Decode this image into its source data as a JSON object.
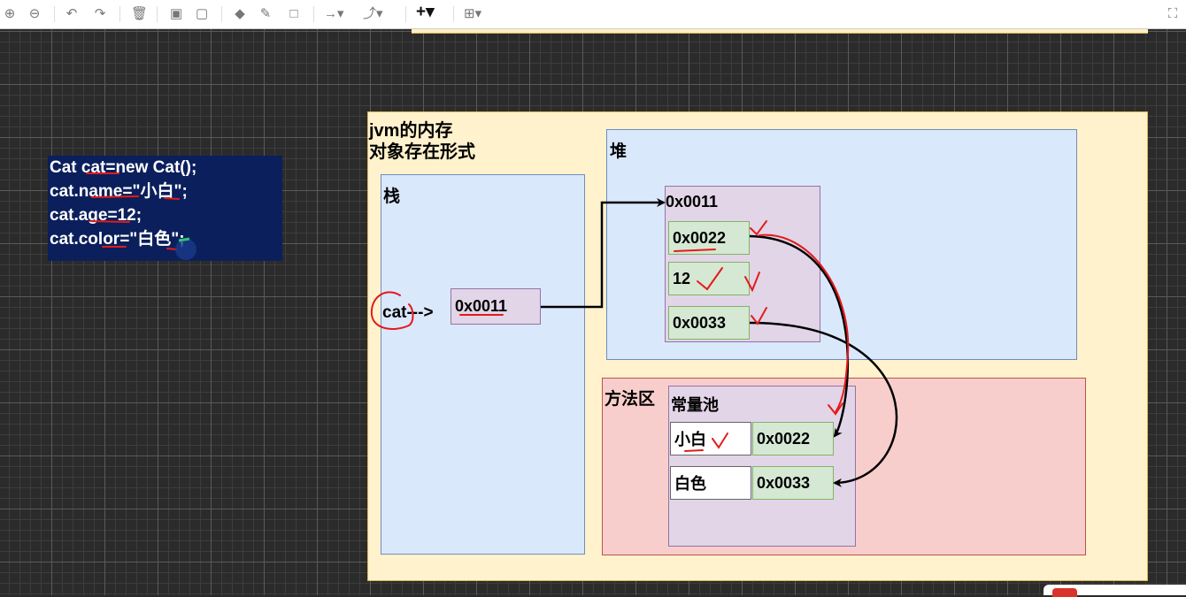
{
  "toolbar": {
    "items": [
      {
        "name": "zoom-in-icon",
        "glyph": "⊕"
      },
      {
        "name": "zoom-out-icon",
        "glyph": "⊖"
      },
      {
        "name": "undo-icon",
        "glyph": "↶"
      },
      {
        "name": "redo-icon",
        "glyph": "↷"
      },
      {
        "name": "delete-icon",
        "glyph": "🗑"
      },
      {
        "name": "to-front-icon",
        "glyph": "▣"
      },
      {
        "name": "to-back-icon",
        "glyph": "▢"
      },
      {
        "name": "fill-color-icon",
        "glyph": "◆"
      },
      {
        "name": "line-color-icon",
        "glyph": "✎"
      },
      {
        "name": "shadow-icon",
        "glyph": "□"
      },
      {
        "name": "connection-style-icon",
        "glyph": "→▾"
      },
      {
        "name": "waypoints-icon",
        "glyph": "⤴▾"
      },
      {
        "name": "insert-icon",
        "glyph": "+▾"
      },
      {
        "name": "table-icon",
        "glyph": "⊞▾"
      },
      {
        "name": "fullscreen-icon",
        "glyph": "⛶"
      }
    ]
  },
  "code": {
    "lines": [
      "Cat cat=new Cat();",
      "cat.name=\"小白\";",
      "cat.age=12;",
      "cat.color=\"白色\";"
    ]
  },
  "diagram": {
    "jvm_title_line1": "jvm的内存",
    "jvm_title_line2": "对象存在形式",
    "stack_label": "栈",
    "heap_label": "堆",
    "method_label": "方法区",
    "pool_label": "常量池",
    "cat_ref": "cat--->",
    "stack_address": "0x0011",
    "heap_object_address": "0x0011",
    "heap_fields": [
      "0x0022",
      "12",
      "0x0033"
    ],
    "pool_rows": [
      {
        "text": "小白",
        "address": "0x0022"
      },
      {
        "text": "白色",
        "address": "0x0033"
      }
    ]
  },
  "colors": {
    "jvm_fill": "#fff2cc",
    "blue_fill": "#dae8fc",
    "red_fill": "#f8cecc",
    "purple_fill": "#e1d5e7",
    "green_fill": "#d5e8d4",
    "annotation_red": "#e31b1b",
    "code_bg": "#0b1f5c"
  }
}
